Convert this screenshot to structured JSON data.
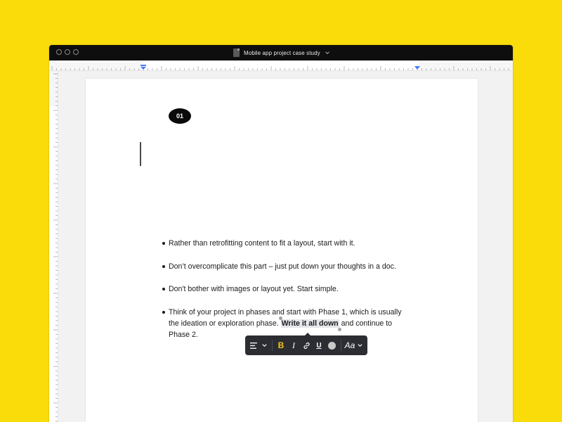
{
  "window": {
    "title": "Mobile app project case study"
  },
  "document": {
    "section_number": "01",
    "bullets": [
      {
        "text": "Rather than retrofitting content to fit a layout, start with it."
      },
      {
        "text": "Don’t overcomplicate this part – just put down your thoughts in a doc."
      },
      {
        "text": "Don't bother with images or layout yet. Start simple."
      },
      {
        "text_line1": "Think of your project in phases and start with Phase 1, which is usually",
        "text_before": "the ideation or exploration phase.",
        "text_selected": "Write it all down",
        "text_after": "and continue to",
        "text_line3": "Phase 2."
      }
    ]
  },
  "toolbar": {
    "bold_label": "B",
    "italic_label": "I",
    "underline_label": "U",
    "font_label": "Aa",
    "accent_color": "#F5C518",
    "color_swatch": "#C9C9C9"
  },
  "colors": {
    "background": "#FADC0A",
    "ruler_marker": "#4A7CFA",
    "toolbar_bg": "#2B2D33"
  }
}
